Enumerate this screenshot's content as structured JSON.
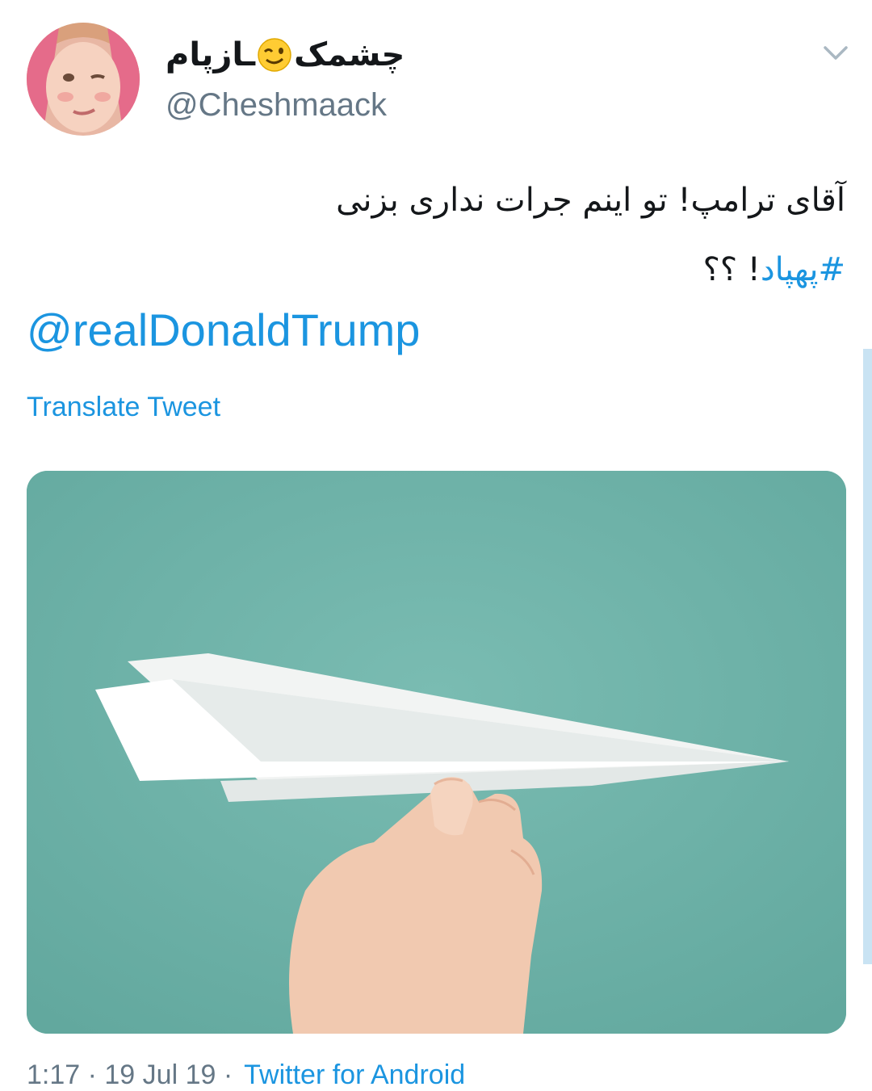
{
  "tweet": {
    "author": {
      "display_name_part1": "چشمک",
      "display_name_emoji": "winking-face-emoji",
      "display_name_part2": "ـازپام",
      "handle": "@Cheshmaack",
      "avatar": "avatar-photo"
    },
    "menu_icon": "chevron-down-icon",
    "text_line1": "آقای ترامپ! تو اینم جرات نداری بزنی",
    "text_line2_hashtag": "#پهپاد",
    "text_line2_rest": "! ؟؟",
    "mention": "@realDonaldTrump",
    "translate_label": "Translate Tweet",
    "media": {
      "description_icon": "paper-airplane-photo"
    },
    "footer": {
      "timestamp": "1:17 · 19 Jul 19 ·",
      "source": "Twitter for Android"
    }
  },
  "colors": {
    "link": "#1b95e0",
    "text": "#14171a",
    "secondary": "#657786",
    "media_background": "#6fb1a8"
  }
}
